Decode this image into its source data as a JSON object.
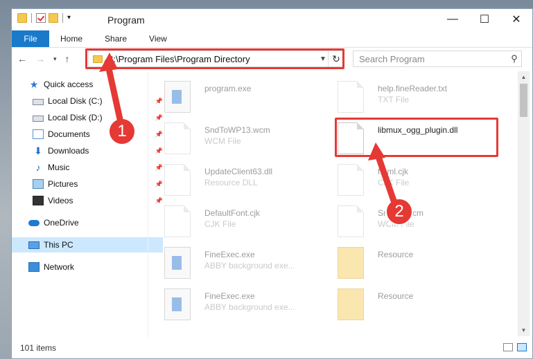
{
  "window": {
    "title": "Program",
    "controls": {
      "minimize": "—",
      "maximize": "☐",
      "close": "✕"
    }
  },
  "ribbon": {
    "tabs": [
      "File",
      "Home",
      "Share",
      "View"
    ]
  },
  "address_bar": {
    "path": "C:\\Program Files\\Program Directory"
  },
  "search": {
    "placeholder": "Search Program"
  },
  "sidebar": {
    "items": [
      {
        "label": "Quick access",
        "icon": "star-icon"
      },
      {
        "label": "Local Disk (C:)",
        "icon": "drive-icon",
        "pinned": true
      },
      {
        "label": "Local Disk (D:)",
        "icon": "drive-icon",
        "pinned": true
      },
      {
        "label": "Documents",
        "icon": "documents-icon",
        "pinned": true
      },
      {
        "label": "Downloads",
        "icon": "download-icon",
        "pinned": true
      },
      {
        "label": "Music",
        "icon": "music-icon",
        "pinned": true
      },
      {
        "label": "Pictures",
        "icon": "pictures-icon",
        "pinned": true
      },
      {
        "label": "Videos",
        "icon": "videos-icon",
        "pinned": true
      },
      {
        "label": "OneDrive",
        "icon": "cloud-icon"
      },
      {
        "label": "This PC",
        "icon": "computer-icon",
        "selected": true
      },
      {
        "label": "Network",
        "icon": "network-icon"
      }
    ]
  },
  "files": [
    {
      "name": "program.exe",
      "type": ""
    },
    {
      "name": "help.fineReader.txt",
      "type": "TXT File"
    },
    {
      "name": "SndToWP13.wcm",
      "type": "WCM File"
    },
    {
      "name": "libmux_ogg_plugin.dll",
      "type": ""
    },
    {
      "name": "UpdateClient63.dll",
      "type": "Resource DLL"
    },
    {
      "name": "f...ml.cjk",
      "type": "CJK File"
    },
    {
      "name": "DefaultFont.cjk",
      "type": "CJK File"
    },
    {
      "name": "Snd...4.wcm",
      "type": "WCM File"
    },
    {
      "name": "FineExec.exe",
      "type": "ABBY background exe..."
    },
    {
      "name": "Resource",
      "type": ""
    },
    {
      "name": "FineExec.exe",
      "type": "ABBY background exe..."
    },
    {
      "name": "Resource",
      "type": ""
    }
  ],
  "status": {
    "item_count": "101 items"
  },
  "annotations": {
    "step1": "1",
    "step2": "2"
  },
  "colors": {
    "accent": "#1979ca",
    "highlight": "#e53935"
  }
}
